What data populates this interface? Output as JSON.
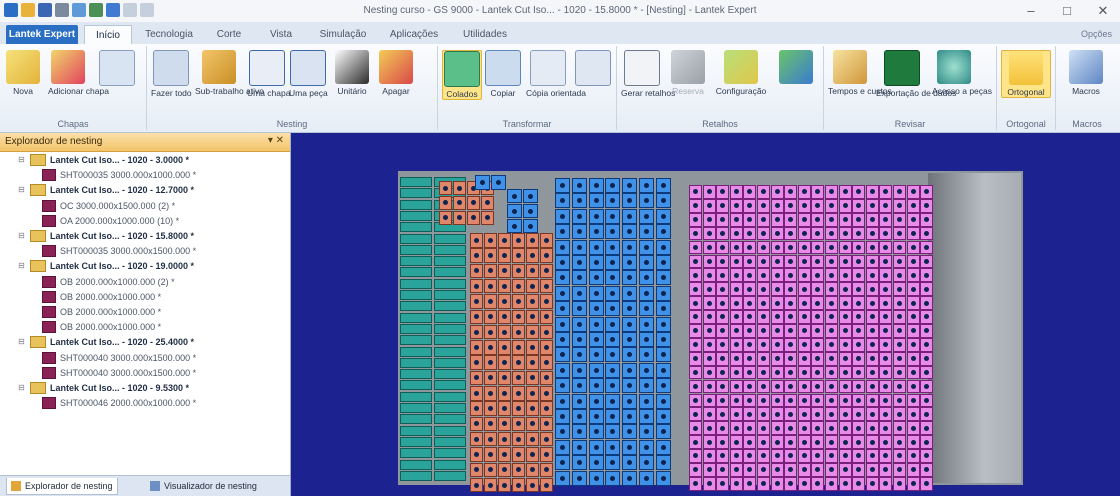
{
  "window": {
    "title": "Nesting curso - GS 9000 - Lantek Cut Iso... - 1020 - 15.8000 * - [Nesting] - Lantek Expert"
  },
  "tabs": [
    {
      "label": "Lantek Expert",
      "type": "app"
    },
    {
      "label": "Início",
      "type": "active"
    },
    {
      "label": "Tecnologia"
    },
    {
      "label": "Corte"
    },
    {
      "label": "Vista"
    },
    {
      "label": "Simulação"
    },
    {
      "label": "Aplicações"
    },
    {
      "label": "Utilidades"
    }
  ],
  "options_label": "Opções",
  "ribbon": {
    "groups": [
      {
        "name": "Chapas",
        "buttons": [
          "Nova",
          "Adicionar chapa",
          ""
        ]
      },
      {
        "name": "Nesting",
        "buttons": [
          "Fazer todo",
          "Sub-trabalho ativo",
          "Uma chapa",
          "Uma peça",
          "Unitário",
          "Apagar"
        ]
      },
      {
        "name": "Transformar",
        "buttons": [
          "Colados",
          "Copiar",
          "Cópia orientada",
          ""
        ]
      },
      {
        "name": "Retalhos",
        "buttons": [
          "Gerar retalhos",
          "Reserva",
          "Configuração",
          ""
        ]
      },
      {
        "name": "Revisar",
        "buttons": [
          "Tempos e custos",
          "Exportação de dados",
          "Acesso a peças",
          ""
        ]
      },
      {
        "name": "Ortogonal",
        "buttons": [
          "Ortogonal"
        ]
      },
      {
        "name": "Macros",
        "buttons": [
          "Macros"
        ]
      }
    ]
  },
  "explorer": {
    "title": "Explorador de nesting",
    "controls": "▾ ✕",
    "tree": [
      {
        "level": 0,
        "label": "Lantek Cut Iso... - 1020 - 3.0000 *"
      },
      {
        "level": 1,
        "label": "SHT000035 3000.000x1000.000 *"
      },
      {
        "level": 0,
        "label": "Lantek Cut Iso... - 1020 - 12.7000 *"
      },
      {
        "level": 1,
        "label": "OC 3000.000x1500.000 (2) *"
      },
      {
        "level": 1,
        "label": "OA 2000.000x1000.000 (10) *"
      },
      {
        "level": 0,
        "label": "Lantek Cut Iso... - 1020 - 15.8000 *"
      },
      {
        "level": 1,
        "label": "SHT000035 3000.000x1500.000 *"
      },
      {
        "level": 0,
        "label": "Lantek Cut Iso... - 1020 - 19.0000 *"
      },
      {
        "level": 1,
        "label": "OB 2000.000x1000.000 (2) *"
      },
      {
        "level": 1,
        "label": "OB 2000.000x1000.000 *"
      },
      {
        "level": 1,
        "label": "OB 2000.000x1000.000 *"
      },
      {
        "level": 1,
        "label": "OB 2000.000x1000.000 *"
      },
      {
        "level": 0,
        "label": "Lantek Cut Iso... - 1020 - 25.4000 *"
      },
      {
        "level": 1,
        "label": "SHT000040 3000.000x1500.000 *"
      },
      {
        "level": 1,
        "label": "SHT000040 3000.000x1500.000 *"
      },
      {
        "level": 0,
        "label": "Lantek Cut Iso... - 1020 - 9.5300 *"
      },
      {
        "level": 1,
        "label": "SHT000046 2000.000x1000.000 *"
      }
    ],
    "footer_tabs": [
      "Explorador de nesting",
      "Visualizador de nesting"
    ]
  },
  "colors": {
    "canvas": "#1c2290",
    "teal": "#2aa39a",
    "salmon": "#e0866b",
    "blue": "#3f92e8",
    "pink": "#e88ae8"
  }
}
